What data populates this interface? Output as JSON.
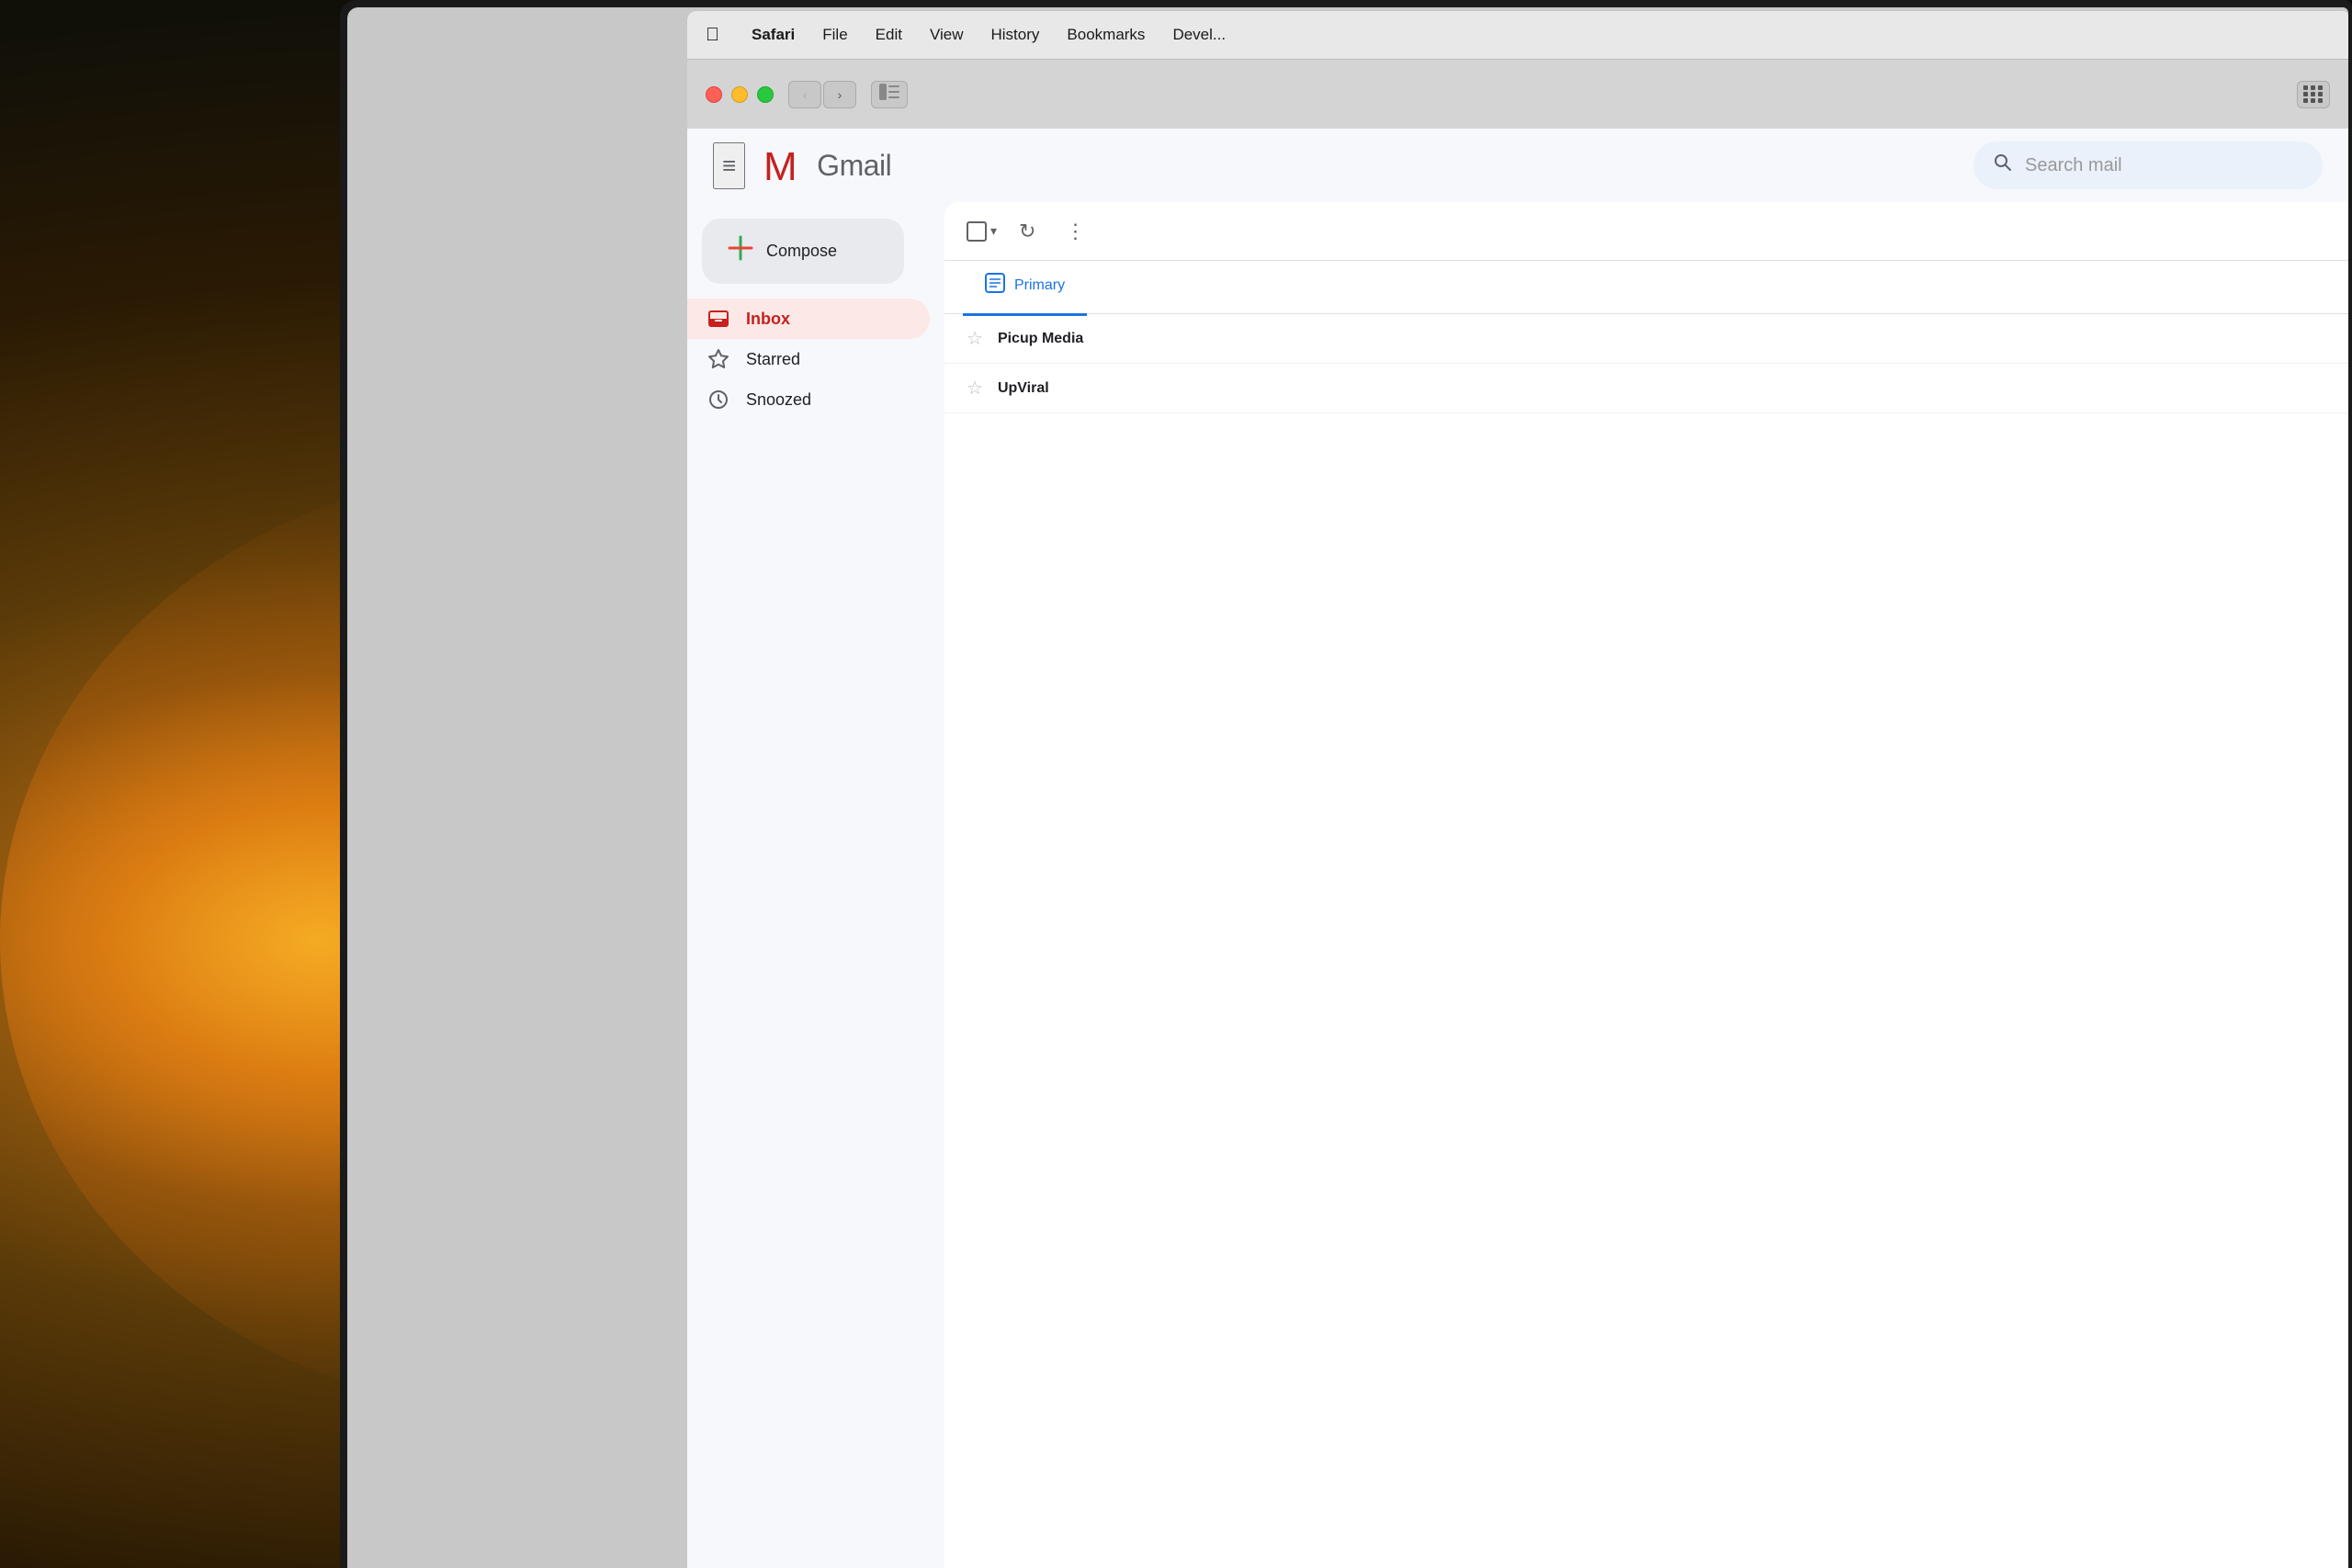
{
  "background": {
    "description": "Warm bokeh background with glowing light"
  },
  "menubar": {
    "apple_symbol": "🍎",
    "items": [
      {
        "label": "Safari",
        "bold": true
      },
      {
        "label": "File",
        "bold": false
      },
      {
        "label": "Edit",
        "bold": false
      },
      {
        "label": "View",
        "bold": false
      },
      {
        "label": "History",
        "bold": false
      },
      {
        "label": "Bookmarks",
        "bold": false
      },
      {
        "label": "Devel...",
        "bold": false
      }
    ]
  },
  "browser": {
    "nav_back": "‹",
    "nav_forward": "›",
    "sidebar_icon": "▣",
    "grid_icon": "grid"
  },
  "gmail": {
    "header": {
      "hamburger": "≡",
      "logo_text": "Gmail",
      "search_placeholder": "Search mail"
    },
    "compose_button": "Compose",
    "nav_items": [
      {
        "id": "inbox",
        "label": "Inbox",
        "icon": "inbox",
        "active": true
      },
      {
        "id": "starred",
        "label": "Starred",
        "icon": "star",
        "active": false
      },
      {
        "id": "snoozed",
        "label": "Snoozed",
        "icon": "clock",
        "active": false
      }
    ],
    "toolbar": {
      "more_options": "⋮",
      "refresh": "↻"
    },
    "tabs": [
      {
        "id": "primary",
        "label": "Primary",
        "active": true
      }
    ],
    "email_rows": [
      {
        "sender": "Picup Media",
        "star": false
      },
      {
        "sender": "UpViral",
        "star": false
      }
    ]
  }
}
